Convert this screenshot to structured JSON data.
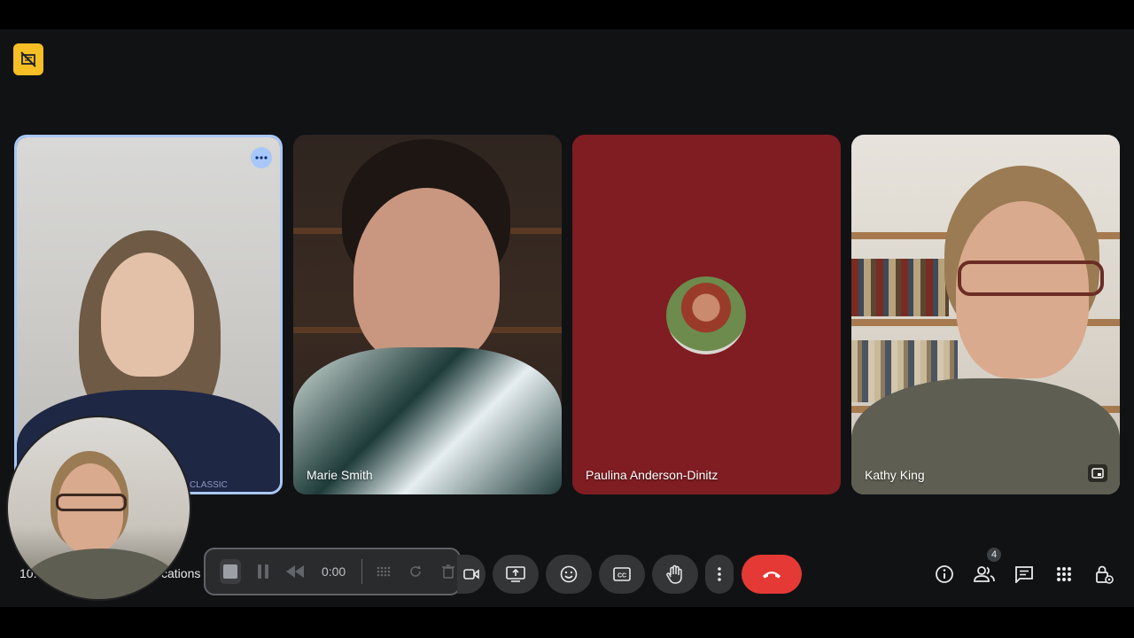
{
  "participants": [
    {
      "name": "",
      "shirt_text": "CLASSIC"
    },
    {
      "name": "Marie Smith"
    },
    {
      "name": "Paulina Anderson-Dinitz"
    },
    {
      "name": "Kathy King"
    }
  ],
  "meeting": {
    "time_partial": "10:",
    "title_partial": "cations"
  },
  "recording": {
    "timer": "0:00"
  },
  "toolbar": {
    "people_count": "4"
  },
  "colors": {
    "accent_border": "#a8c7fa",
    "end_call": "#e53935",
    "avatar_tile_bg": "#7f1d22",
    "logo_badge": "#f6bf26"
  },
  "icons": [
    "no-video-badge-icon",
    "more-options-icon",
    "pin-icon",
    "stop-icon",
    "pause-icon",
    "rewind-icon",
    "soundwave-icon",
    "reset-icon",
    "trash-icon",
    "camera-icon",
    "present-icon",
    "emoji-icon",
    "captions-icon",
    "raise-hand-icon",
    "more-vert-icon",
    "end-call-icon",
    "info-icon",
    "people-icon",
    "chat-icon",
    "apps-icon",
    "host-controls-icon"
  ]
}
